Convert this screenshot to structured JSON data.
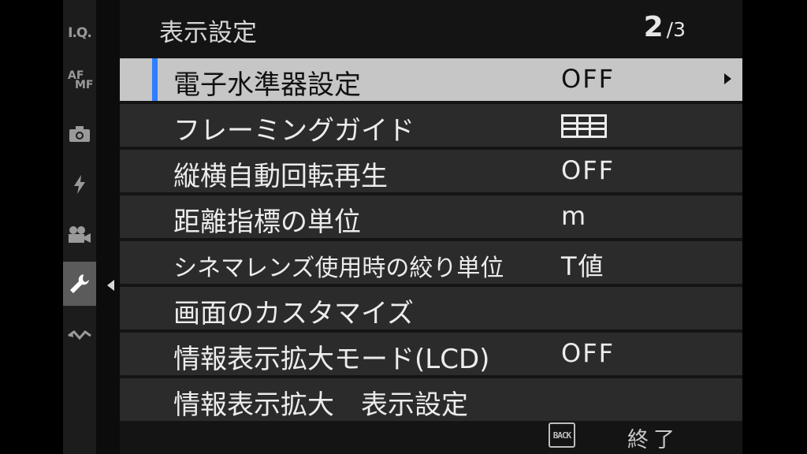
{
  "sidebar": {
    "items": [
      {
        "icon": "iq-icon",
        "text": "I.Q."
      },
      {
        "icon": "af-mf-icon",
        "text_top": "AF",
        "text_bottom": "MF"
      },
      {
        "icon": "camera-icon"
      },
      {
        "icon": "flash-icon"
      },
      {
        "icon": "movie-icon"
      },
      {
        "icon": "wrench-icon",
        "active": true
      },
      {
        "icon": "wireless-icon"
      }
    ]
  },
  "header": {
    "title": "表示設定",
    "page_current": "2",
    "page_total": "/3"
  },
  "menu": {
    "items": [
      {
        "label": "電子水準器設定",
        "value": "OFF"
      },
      {
        "label": "フレーミングガイド",
        "value_icon": "grid-guide-icon"
      },
      {
        "label": "縦横自動回転再生",
        "value": "OFF"
      },
      {
        "label": "距離指標の単位",
        "value": "m"
      },
      {
        "label": "シネマレンズ使用時の絞り単位",
        "value": "T値"
      },
      {
        "label": "画面のカスタマイズ"
      },
      {
        "label": "情報表示拡大モード(LCD)",
        "value": "OFF"
      },
      {
        "label": "情報表示拡大　表示設定"
      }
    ]
  },
  "footer": {
    "back_label": "BACK",
    "end_label": "終了"
  },
  "colors": {
    "selection_marker": "#2d7fff",
    "selected_row": "#c6c6c6",
    "row": "#2b2b2b"
  }
}
